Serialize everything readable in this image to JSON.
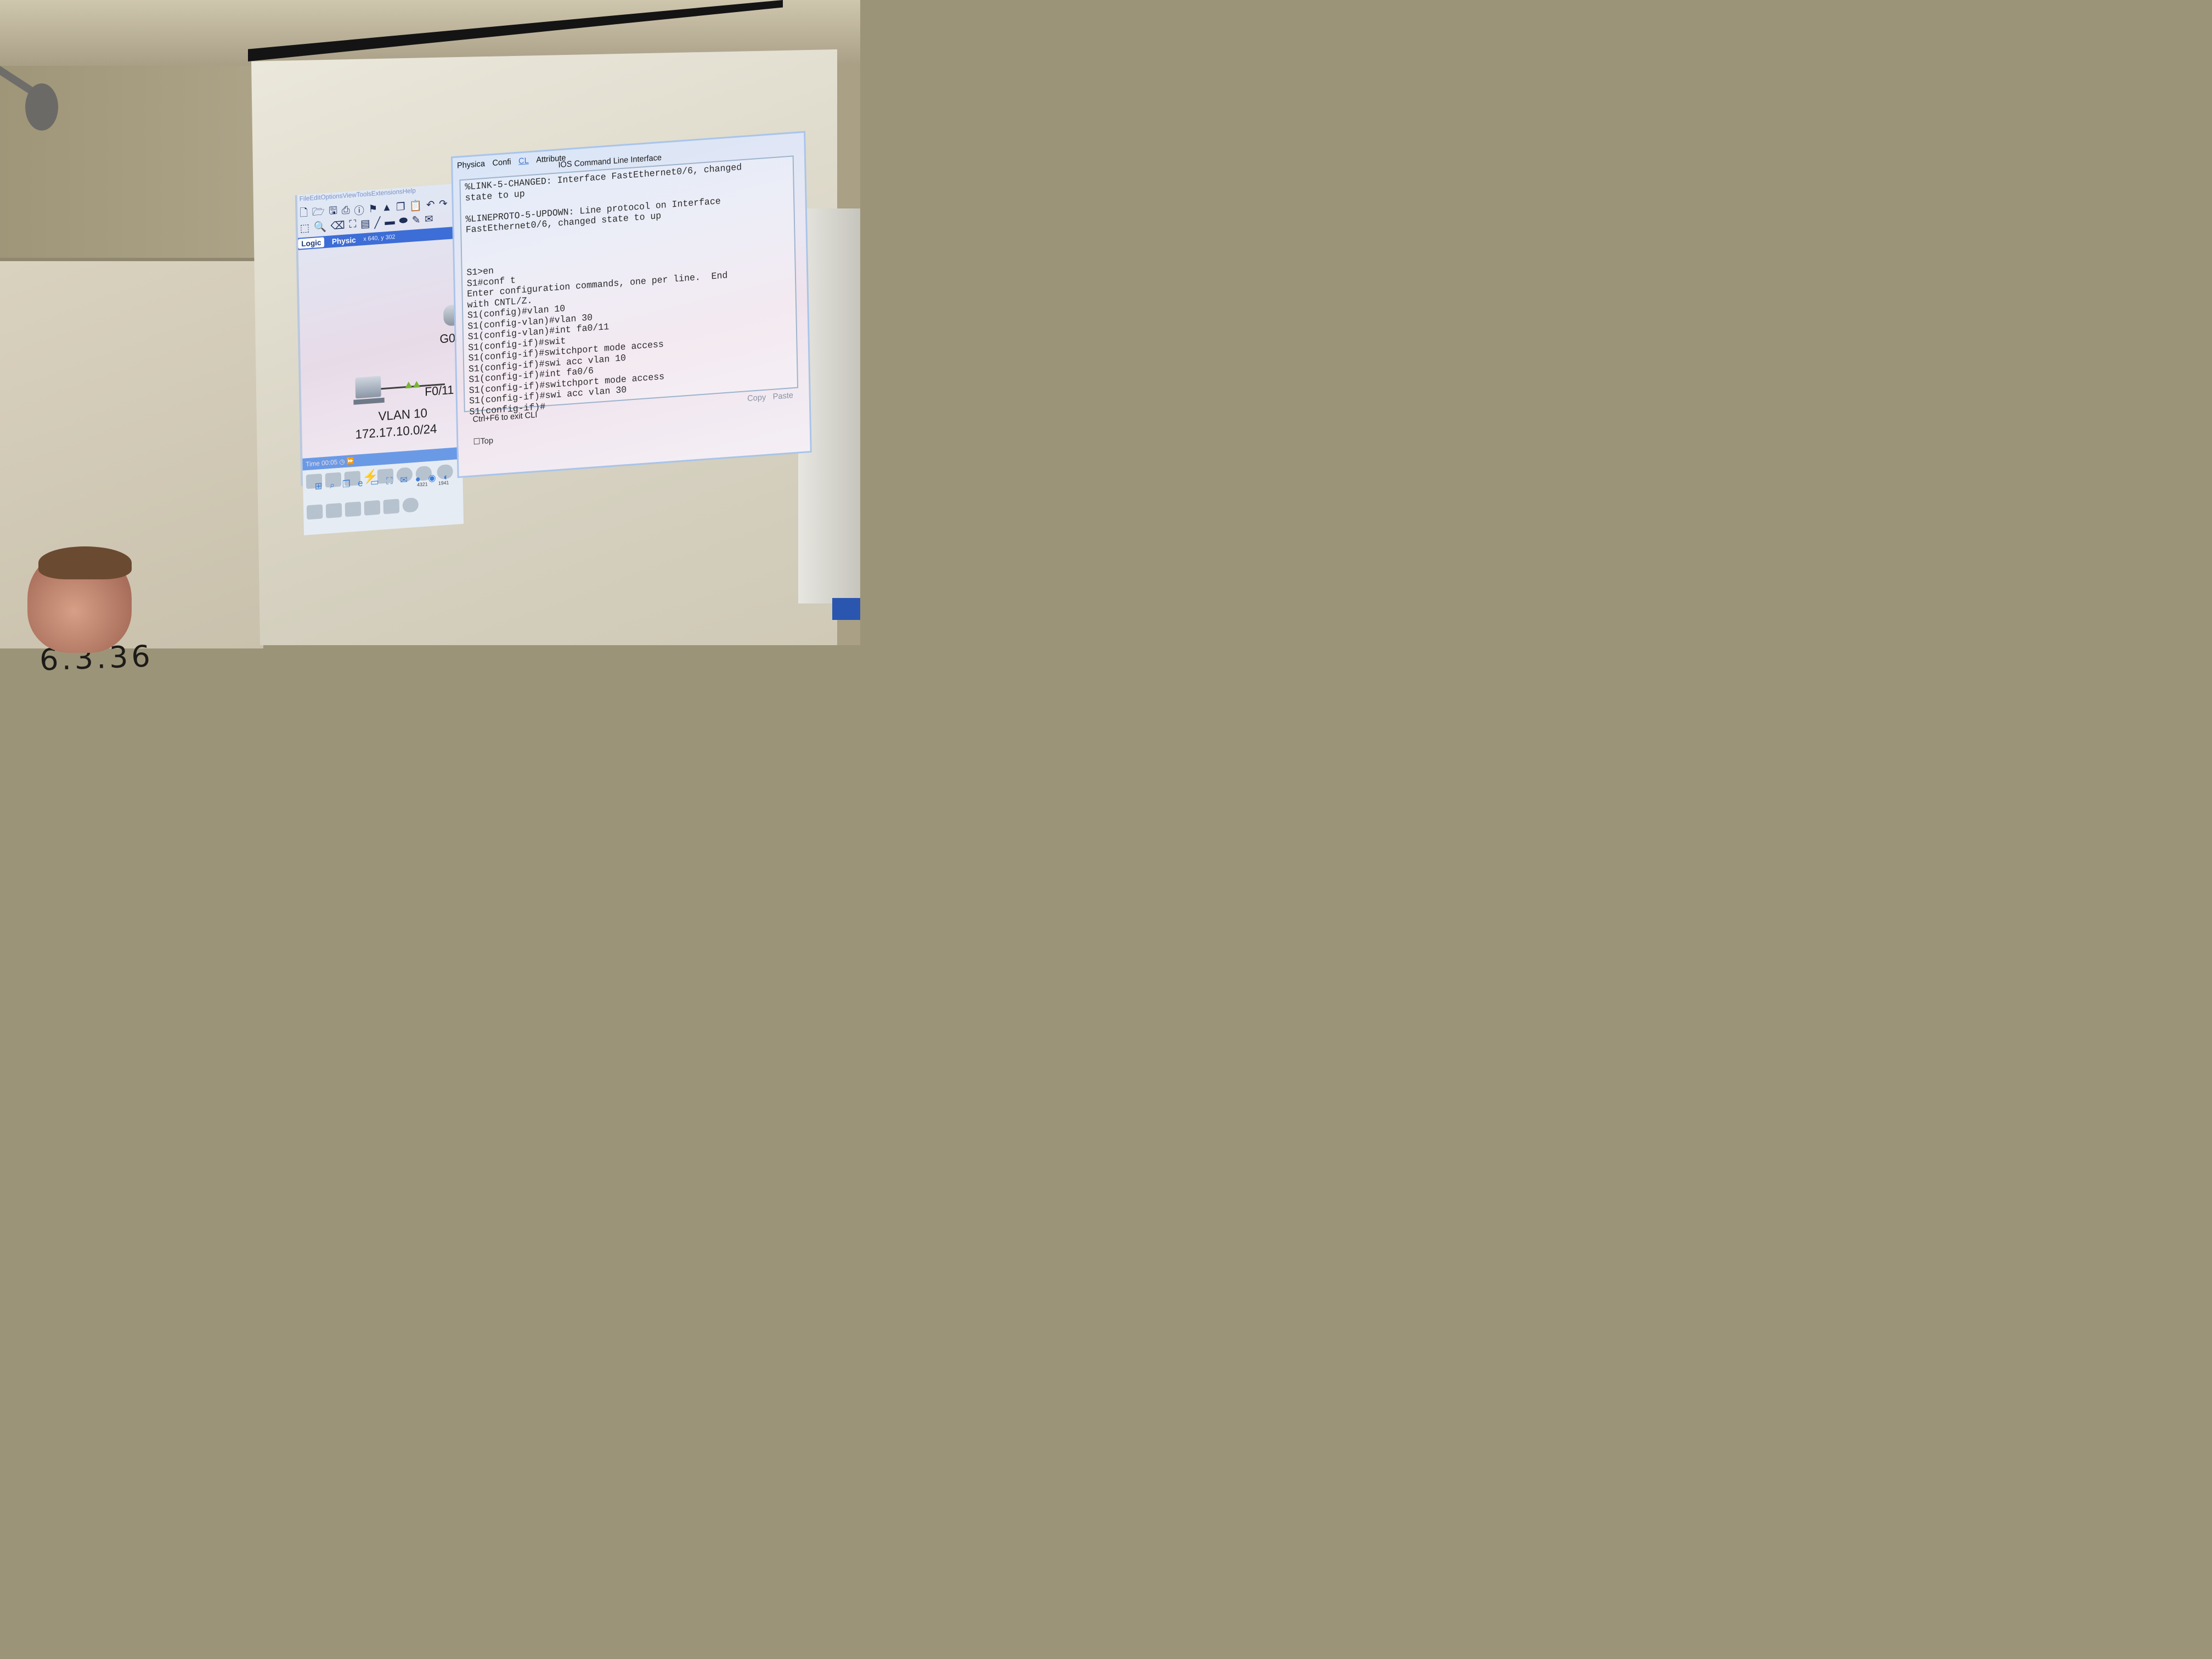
{
  "whiteboard": {
    "handwriting": "6.3.36"
  },
  "packet_tracer": {
    "menu": [
      "File",
      "Edit",
      "Options",
      "View",
      "Tools",
      "Extensions",
      "Help"
    ],
    "tabs": {
      "logical": "Logic",
      "physical": "Physic"
    },
    "coords": {
      "x_label": "x",
      "x_value": "640",
      "y_label": "y",
      "y_value": "302"
    },
    "topology": {
      "router_port": "G0/",
      "switch_port": "F0/11",
      "vlan_name": "VLAN 10",
      "subnet": "172.17.10.0/24"
    },
    "time_bar": {
      "label": "Time",
      "value": "00:05"
    },
    "device_models": [
      "4321",
      "1941"
    ]
  },
  "cli_window": {
    "tabs": [
      "Physica",
      "Confi",
      "CL",
      "Attribute"
    ],
    "title": "IOS Command Line Interface",
    "output": "%LINK-5-CHANGED: Interface FastEthernet0/6, changed\nstate to up\n\n%LINEPROTO-5-UPDOWN: Line protocol on Interface\nFastEthernet0/6, changed state to up\n\n\n\nS1>en\nS1#conf t\nEnter configuration commands, one per line.  End\nwith CNTL/Z.\nS1(config)#vlan 10\nS1(config-vlan)#vlan 30\nS1(config-vlan)#int fa0/11\nS1(config-if)#swit\nS1(config-if)#switchport mode access\nS1(config-if)#swi acc vlan 10\nS1(config-if)#int fa0/6\nS1(config-if)#switchport mode access\nS1(config-if)#swi acc vlan 30\nS1(config-if)#",
    "hint": "Ctrl+F6 to exit CLI",
    "copy_label": "Copy",
    "paste_label": "Paste",
    "top_label": "Top"
  },
  "taskbar": {
    "icons": [
      "windows-icon",
      "search-icon",
      "task-view-icon",
      "edge-icon",
      "explorer-icon",
      "store-icon",
      "mail-icon",
      "firefox-icon",
      "chrome-icon",
      "packet-tracer-icon"
    ]
  },
  "colors": {
    "tab_bar": "#3d6dd6",
    "cli_border": "#a9c4ea",
    "link_green": "#79b339"
  }
}
